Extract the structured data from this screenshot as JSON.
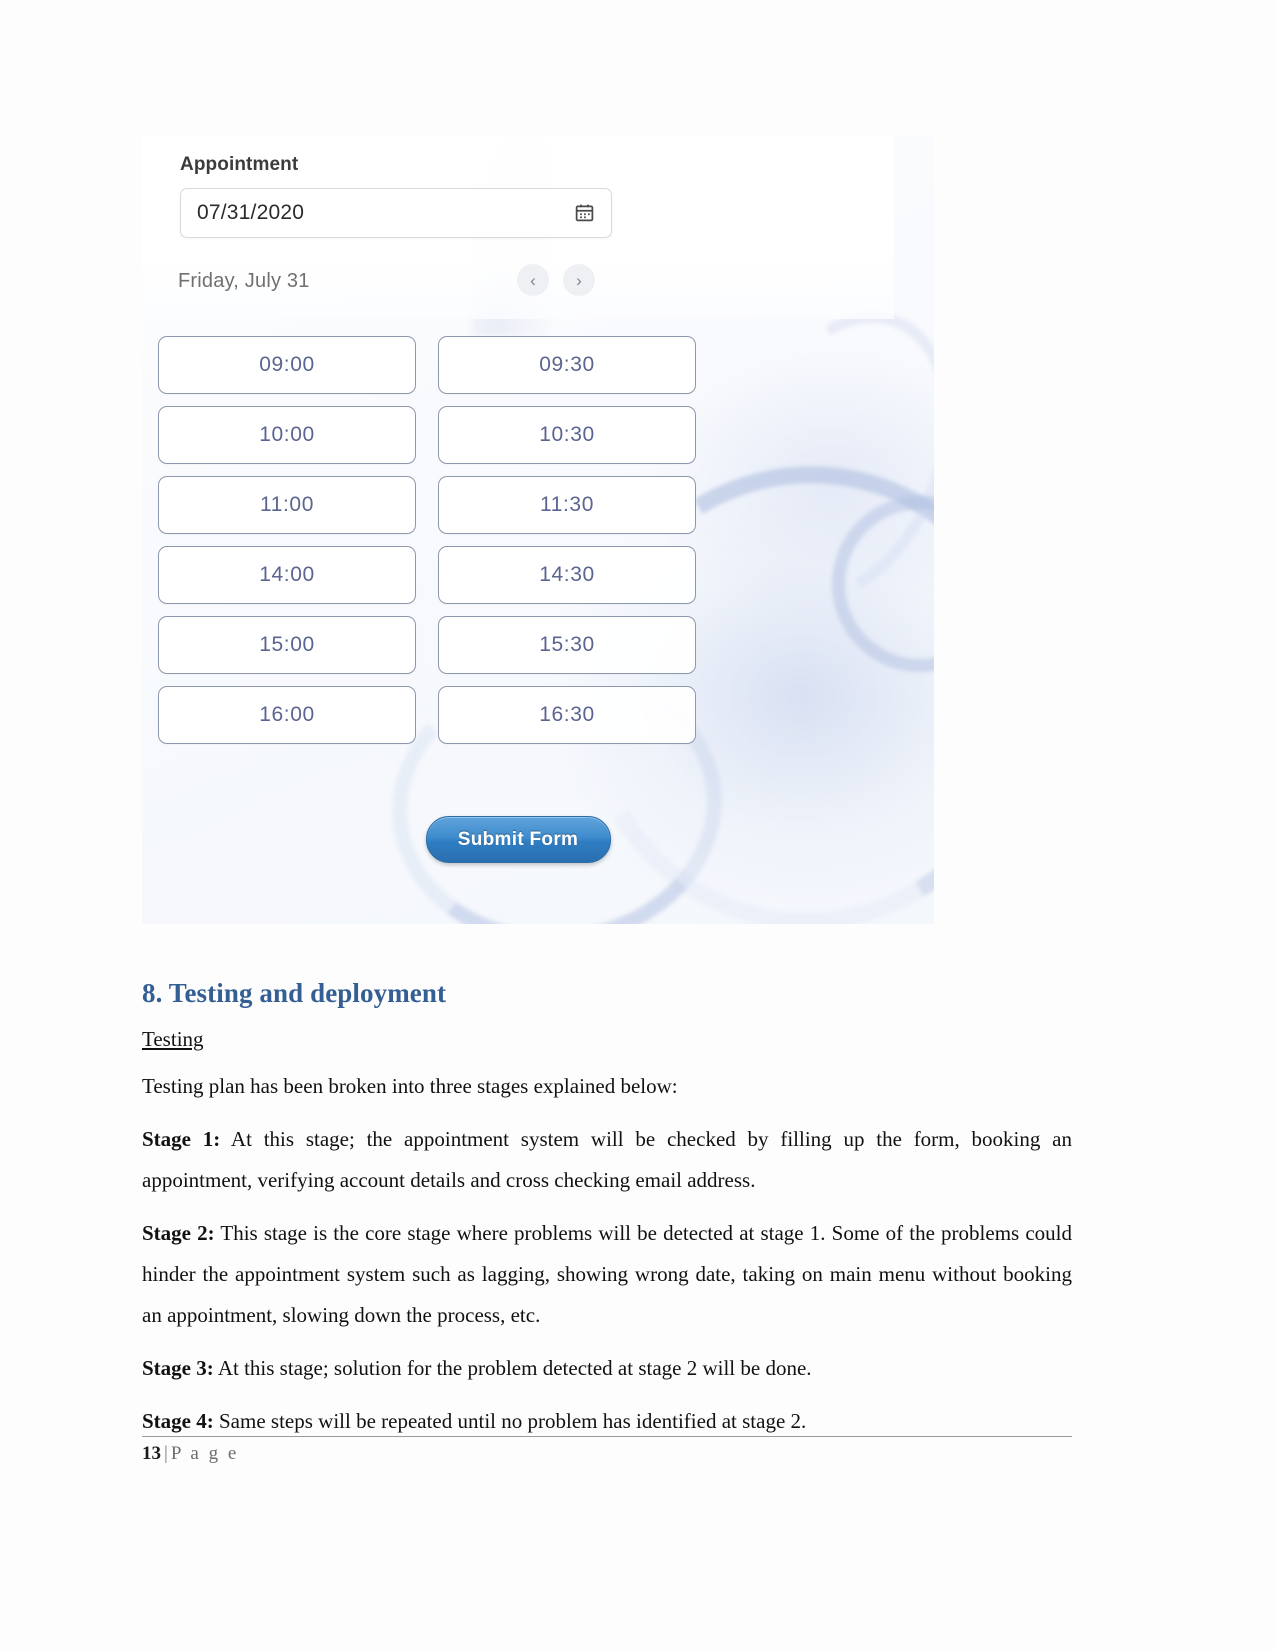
{
  "figure": {
    "appointment": {
      "label": "Appointment",
      "date_value": "07/31/2020",
      "calendar_icon": "calendar-icon",
      "weekday_line": "Friday, July 31",
      "prev_label": "‹",
      "next_label": "›"
    },
    "time_slots": [
      "09:00",
      "09:30",
      "10:00",
      "10:30",
      "11:00",
      "11:30",
      "14:00",
      "14:30",
      "15:00",
      "15:30",
      "16:00",
      "16:30"
    ],
    "submit_label": "Submit Form",
    "colors": {
      "slot_text": "#5b6590",
      "slot_border": "#8d97ae",
      "submit_blue": "#2f7dc2"
    }
  },
  "document": {
    "heading": "8. Testing and deployment",
    "subheading": "Testing",
    "intro": "Testing plan has been broken into three stages explained below:",
    "stages": [
      {
        "label": "Stage 1:",
        "text": " At this stage; the appointment system will be checked by filling up the form, booking an appointment, verifying account details and cross checking email address."
      },
      {
        "label": "Stage 2:",
        "text": " This stage is the core stage where problems will be detected at stage 1. Some of the problems could hinder the appointment system such as lagging, showing wrong date, taking on main menu without booking an appointment, slowing down the process, etc."
      },
      {
        "label": "Stage 3:",
        "text": " At this stage; solution for the problem detected at stage 2 will be done."
      },
      {
        "label": "Stage 4:",
        "text": " Same steps will be repeated until no problem has identified at stage 2."
      }
    ],
    "heading_color": "#345f94"
  },
  "footer": {
    "page_number": "13",
    "separator": "|",
    "page_word": "P a g e"
  }
}
